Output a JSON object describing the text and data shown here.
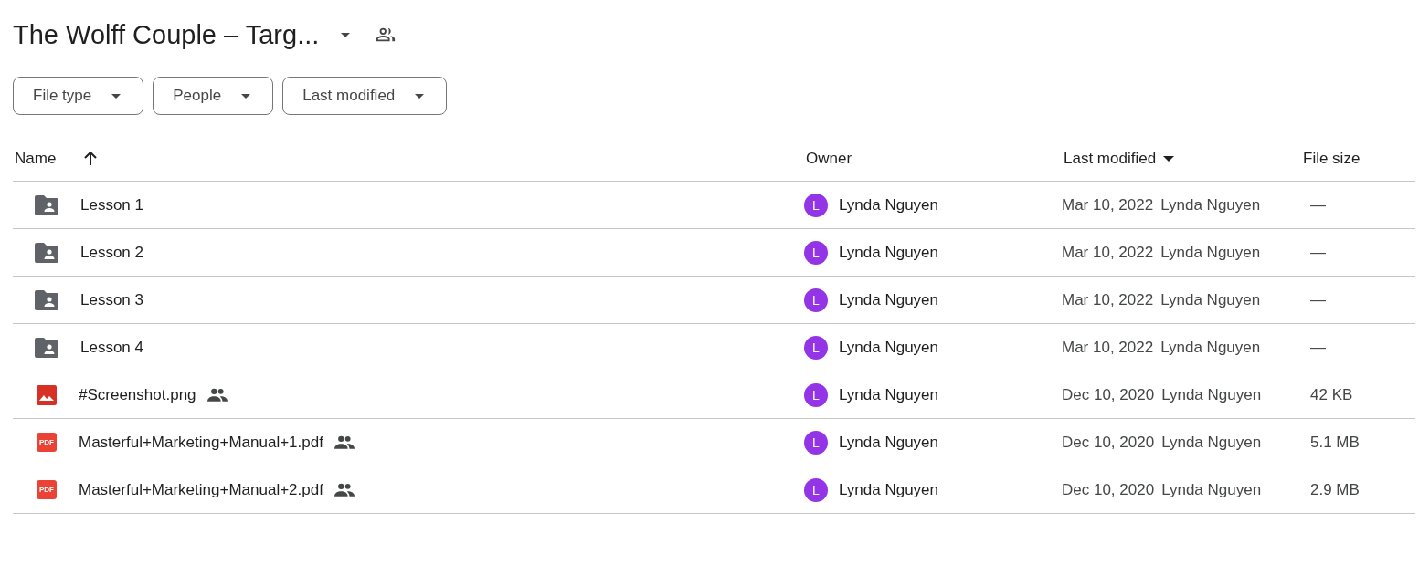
{
  "header": {
    "title": "The Wolff Couple – Targ..."
  },
  "filters": [
    {
      "label": "File type"
    },
    {
      "label": "People"
    },
    {
      "label": "Last modified"
    }
  ],
  "table": {
    "columns": [
      {
        "label": "Name",
        "kind": "ascending"
      },
      {
        "label": "Owner",
        "kind": "plain"
      },
      {
        "label": "Last modified",
        "kind": "descending"
      },
      {
        "label": "File size",
        "kind": "plain"
      }
    ],
    "rows": [
      {
        "kind": "folder",
        "name": "Lesson 1",
        "shared": false,
        "owner": {
          "initial": "L",
          "name": "Lynda Nguyen",
          "color": "#9334e6"
        },
        "modified": "Mar 10, 2022",
        "modified_by": "Lynda Nguyen",
        "size": "—"
      },
      {
        "kind": "folder",
        "name": "Lesson 2",
        "shared": false,
        "owner": {
          "initial": "L",
          "name": "Lynda Nguyen",
          "color": "#9334e6"
        },
        "modified": "Mar 10, 2022",
        "modified_by": "Lynda Nguyen",
        "size": "—"
      },
      {
        "kind": "folder",
        "name": "Lesson 3",
        "shared": false,
        "owner": {
          "initial": "L",
          "name": "Lynda Nguyen",
          "color": "#9334e6"
        },
        "modified": "Mar 10, 2022",
        "modified_by": "Lynda Nguyen",
        "size": "—"
      },
      {
        "kind": "folder",
        "name": "Lesson 4",
        "shared": false,
        "owner": {
          "initial": "L",
          "name": "Lynda Nguyen",
          "color": "#9334e6"
        },
        "modified": "Mar 10, 2022",
        "modified_by": "Lynda Nguyen",
        "size": "—"
      },
      {
        "kind": "image",
        "name": "#Screenshot.png",
        "shared": true,
        "owner": {
          "initial": "L",
          "name": "Lynda Nguyen",
          "color": "#9334e6"
        },
        "modified": "Dec 10, 2020",
        "modified_by": "Lynda Nguyen",
        "size": "42 KB"
      },
      {
        "kind": "pdf",
        "icon_label": "PDF",
        "name": "Masterful+Marketing+Manual+1.pdf",
        "shared": true,
        "owner": {
          "initial": "L",
          "name": "Lynda Nguyen",
          "color": "#9334e6"
        },
        "modified": "Dec 10, 2020",
        "modified_by": "Lynda Nguyen",
        "size": "5.1 MB"
      },
      {
        "kind": "pdf",
        "icon_label": "PDF",
        "name": "Masterful+Marketing+Manual+2.pdf",
        "shared": true,
        "owner": {
          "initial": "L",
          "name": "Lynda Nguyen",
          "color": "#9334e6"
        },
        "modified": "Dec 10, 2020",
        "modified_by": "Lynda Nguyen",
        "size": "2.9 MB"
      }
    ]
  }
}
